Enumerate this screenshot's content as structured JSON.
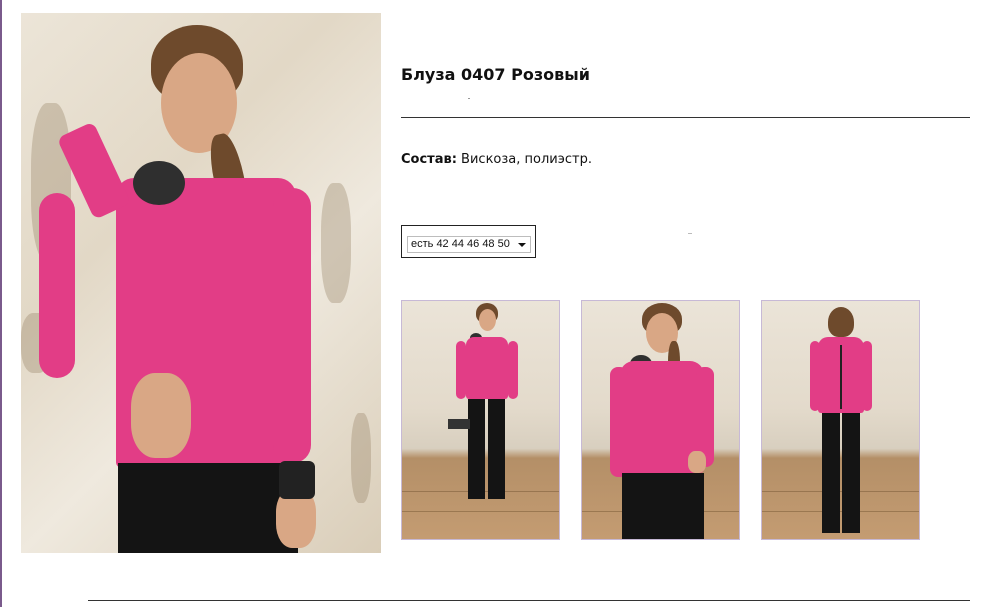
{
  "product": {
    "title": "Блуза 0407 Розовый",
    "composition_label": "Состав:",
    "composition_value": " Вискоза, полиэстр."
  },
  "size": {
    "selected": "есть 42 44 46 48 50"
  },
  "gallery": {
    "thumbnails": [
      {
        "view": "full-length-front"
      },
      {
        "view": "front-close"
      },
      {
        "view": "back"
      }
    ]
  },
  "colors": {
    "blouse": "#e23d86",
    "divider": "#333333",
    "thumb_border": "#c7b9d6"
  }
}
